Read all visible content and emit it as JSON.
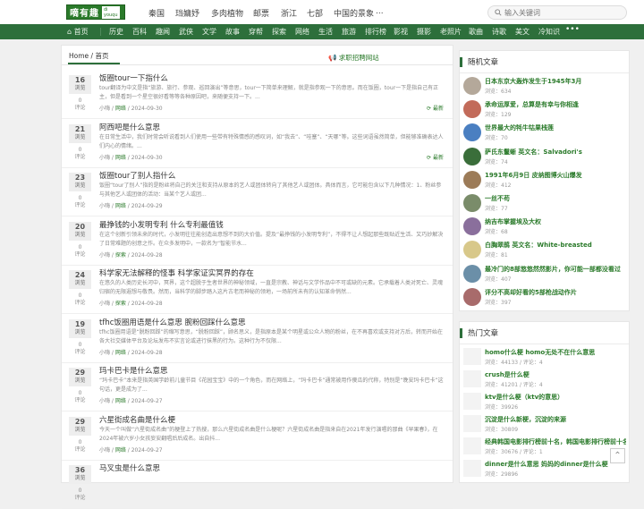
{
  "site": {
    "logo_text": "嘀有趣",
    "logo_sub": "di\nyouqu"
  },
  "topnav": [
    "秦国",
    "珰嫞妤",
    "多肉植物",
    "邮票",
    "浙江",
    "七部",
    "中国的景象",
    "..."
  ],
  "search": {
    "placeholder": "输入关键词"
  },
  "navbar": [
    "首页",
    "历史",
    "百科",
    "趣闻",
    "武侠",
    "文学",
    "故事",
    "穿帮",
    "探索",
    "网络",
    "生活",
    "旅游",
    "排行榜",
    "影视",
    "摄影",
    "老照片",
    "歌曲",
    "诗歌",
    "美文",
    "冷知识"
  ],
  "tabs": {
    "home": "Home / 首页",
    "recruit": "求职招聘网站"
  },
  "articles": [
    {
      "day": "16",
      "unit": "浏览",
      "comments": "0",
      "comments_label": "评论",
      "title": "饭圈tour一下指什么",
      "desc": "tour翻译为中文是指“旅游、旅行、参观、巡回演出”等意思，tour一下简单来理解，就是指参观一下的意思。而在饭圈，tour一下是指自己有正主，但是看到一个星空很好看等等各种原因吧，来随便支持一下。...",
      "author": "小嗨",
      "category": "网络",
      "date": "2024-09-30",
      "refresh": "最新"
    },
    {
      "day": "21",
      "unit": "浏览",
      "comments": "0",
      "comments_label": "评论",
      "title": "阿西吧是什么意思",
      "desc": "在日常生活中，我们时常会听说看到人们使用一些带有特殊情感的感叹词，如“我去”、“哇塞”、“天哪”等。这些词语虽然简单，但能够准确表达人们内心的情绪。...",
      "author": "小嗨",
      "category": "网络",
      "date": "2024-09-30",
      "refresh": "最新"
    },
    {
      "day": "23",
      "unit": "浏览",
      "comments": "0",
      "comments_label": "评论",
      "title": "饭圈tour了别人指什么",
      "desc": "饭圈“tour了别人”指的是粉丝将自己的关注和支持从原本的艺人或团体转向了其他艺人或团体。具体而言，它可能包含以下几种情况：1、粉丝参与其他艺人或团体的活动：当某个艺人或团...",
      "author": "小嗨",
      "category": "网络",
      "date": "2024-09-29",
      "refresh": ""
    },
    {
      "day": "20",
      "unit": "浏览",
      "comments": "0",
      "comments_label": "评论",
      "title": "最挣钱的小发明专利 什么专利最值钱",
      "desc": "在这个创新引领未来的时代，小发明往往能创造出意想不到的大价值。提及“最挣钱的小发明专利”，不得不让人想起那些既贴近生活、又巧妙解决了日常难题的创意之作。在众多发明中，一款名为“智能节水...",
      "author": "小嗨",
      "category": "探索",
      "date": "2024-09-28",
      "refresh": ""
    },
    {
      "day": "24",
      "unit": "浏览",
      "comments": "0",
      "comments_label": "评论",
      "title": "科学家无法解释的怪事 科学家证实冥界的存在",
      "desc": "在悠久的人类历史长河中，冥界，这个超脱于生者世界的神秘领域，一直是宗教、神话与文学作品中不可或缺的元素。它承载着人类对死亡、灵魂归宿的无限遐想与敬畏。然而，当科学的脚步踏入这片古老而神秘的领地，一场前所未有的认知革命悄然...",
      "author": "小嗨",
      "category": "探索",
      "date": "2024-09-28",
      "refresh": ""
    },
    {
      "day": "19",
      "unit": "浏览",
      "comments": "0",
      "comments_label": "评论",
      "title": "tfhc饭圈用语是什么意思 腕粉回踩什么意思",
      "desc": "tfhc饭圈用语是“脱粉回踩”的缩写意思，“脱粉回踩”，顾名思义，是指原本是某个明星或公众人物的粉丝，在不再喜欢或支持对方后，转而开始在各大社交媒体平台及论坛发布不实言论或进行抹黑的行为。这种行为不仅限...",
      "author": "小嗨",
      "category": "网络",
      "date": "2024-09-28",
      "refresh": ""
    },
    {
      "day": "29",
      "unit": "浏览",
      "comments": "0",
      "comments_label": "评论",
      "title": "玛卡巴卡是什么意思",
      "desc": "“玛卡巴卡”本来是指英国学龄前儿童节目《花园宝宝》中的一个角色，而在网络上，“玛卡巴卡”通常被用作傻瓜的代称，特别是“晚安玛卡巴卡”这句话，更是成为了...",
      "author": "小嗨",
      "category": "网络",
      "date": "2024-09-27",
      "refresh": ""
    },
    {
      "day": "29",
      "unit": "浏览",
      "comments": "0",
      "comments_label": "评论",
      "title": "六星街成名曲是什么梗",
      "desc": "今天一个叫做“六星街成名曲”的梗登上了热搜，那么六星街成名曲是什么梗呢？六星街成名曲是指来自在2021年发行演唱的那曲《早果春》，在2024年被六岁小女孩妄安翻唱后后成名。出自抖...",
      "author": "小嗨",
      "category": "网络",
      "date": "2024-09-27",
      "refresh": ""
    },
    {
      "day": "36",
      "unit": "浏览",
      "comments": "0",
      "comments_label": "评论",
      "title": "马叉虫是什么意思",
      "desc": "",
      "author": "",
      "category": "",
      "date": "",
      "refresh": ""
    }
  ],
  "random": {
    "title": "随机文章",
    "items": [
      {
        "title": "日本东京大轰炸发生于1945年3月",
        "views": "浏览：634"
      },
      {
        "title": "承命运厚爱，总算是有幸与你相逢",
        "views": "浏览：129"
      },
      {
        "title": "世界最大的牦牛牯果栈莲",
        "views": "浏览：70"
      },
      {
        "title": "萨氏东鬣蜥 英文名：Salvadori's",
        "views": "浏览：74"
      },
      {
        "title": "1991年6月9日 皮纳图博火山爆发",
        "views": "浏览：412"
      },
      {
        "title": "一丝不苟",
        "views": "浏览：77"
      },
      {
        "title": "纳吉布掌握埃及大权",
        "views": "浏览：68"
      },
      {
        "title": "白胸翠鹃 英文名：White-breasted",
        "views": "浏览：81"
      },
      {
        "title": "最冷门的8部悠悠然然影片，你可能一部都没看过",
        "views": "浏览：407"
      },
      {
        "title": "评分不高却好看的5部枪战动作片",
        "views": "浏览：397"
      }
    ]
  },
  "hot": {
    "title": "热门文章",
    "items": [
      {
        "title": "homo什么梗 homo无处不在什么意思",
        "views": "浏览：44133 / 评论：4"
      },
      {
        "title": "crush是什么梗",
        "views": "浏览：41201 / 评论：4"
      },
      {
        "title": "ktv是什么梗（ktv的意思）",
        "views": "浏览：39926"
      },
      {
        "title": "沉淀是什么新梗，沉淀的来源",
        "views": "浏览：30809"
      },
      {
        "title": "经典韩国电影排行榜前十名，韩国电影排行榜前十名",
        "views": "浏览：30676 / 评论：1"
      },
      {
        "title": "dinner是什么意思 妈妈的dinner是什么梗",
        "views": "浏览：29896"
      }
    ]
  },
  "colors": {
    "brand": "#2d6f3b",
    "link": "#2a7a2a"
  }
}
